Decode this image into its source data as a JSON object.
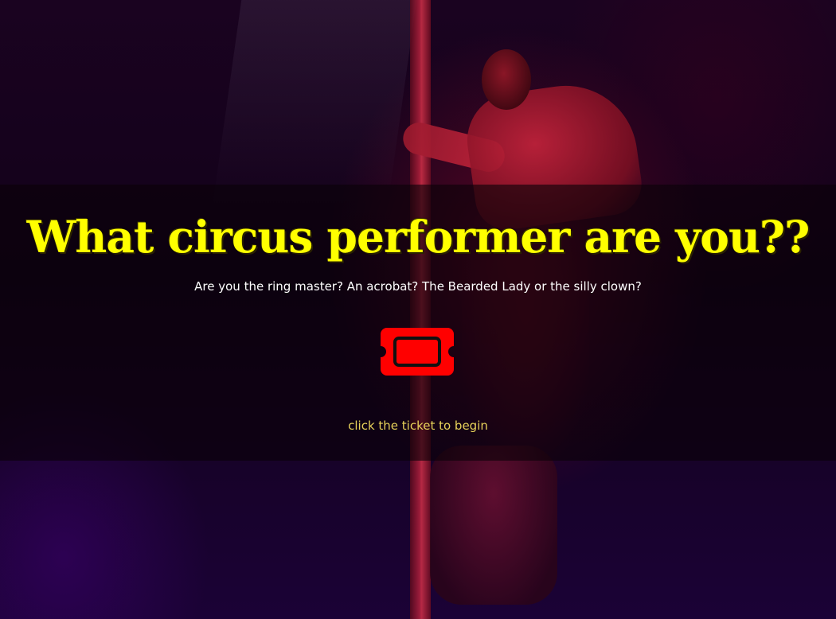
{
  "page": {
    "title": "What circus performer are you??",
    "subtitle": "Are you the ring master? An acrobat? The Bearded Lady or the silly clown?",
    "hint": "click the ticket to begin"
  },
  "ticket": {
    "icon": "ticket-icon",
    "color": "#ff0000",
    "outline_color": "#111111"
  },
  "colors": {
    "title": "#ffff00",
    "subtitle": "#ffffff",
    "hint": "#e8d25a",
    "overlay": "rgba(10, 2, 8, 0.62)"
  }
}
